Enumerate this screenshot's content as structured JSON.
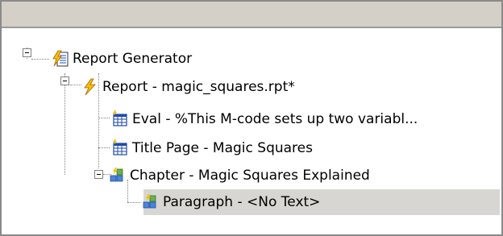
{
  "tree": {
    "nodes": [
      {
        "label": "Report Generator",
        "icon": "report-generator-icon"
      },
      {
        "label": "Report - magic_squares.rpt*",
        "icon": "lightning-icon"
      },
      {
        "label": "Eval - %This M-code sets up two variabl...",
        "icon": "table-grid-icon"
      },
      {
        "label": "Title Page - Magic Squares",
        "icon": "table-grid-icon"
      },
      {
        "label": "Chapter - Magic Squares Explained",
        "icon": "chapter-component-icon"
      },
      {
        "label": "Paragraph - <No Text>",
        "icon": "paragraph-component-icon"
      }
    ],
    "selected_index": 5
  },
  "colors": {
    "header_bar": "#d4d0c8",
    "selection": "#d8d6d2",
    "border": "#8a8a8a"
  }
}
